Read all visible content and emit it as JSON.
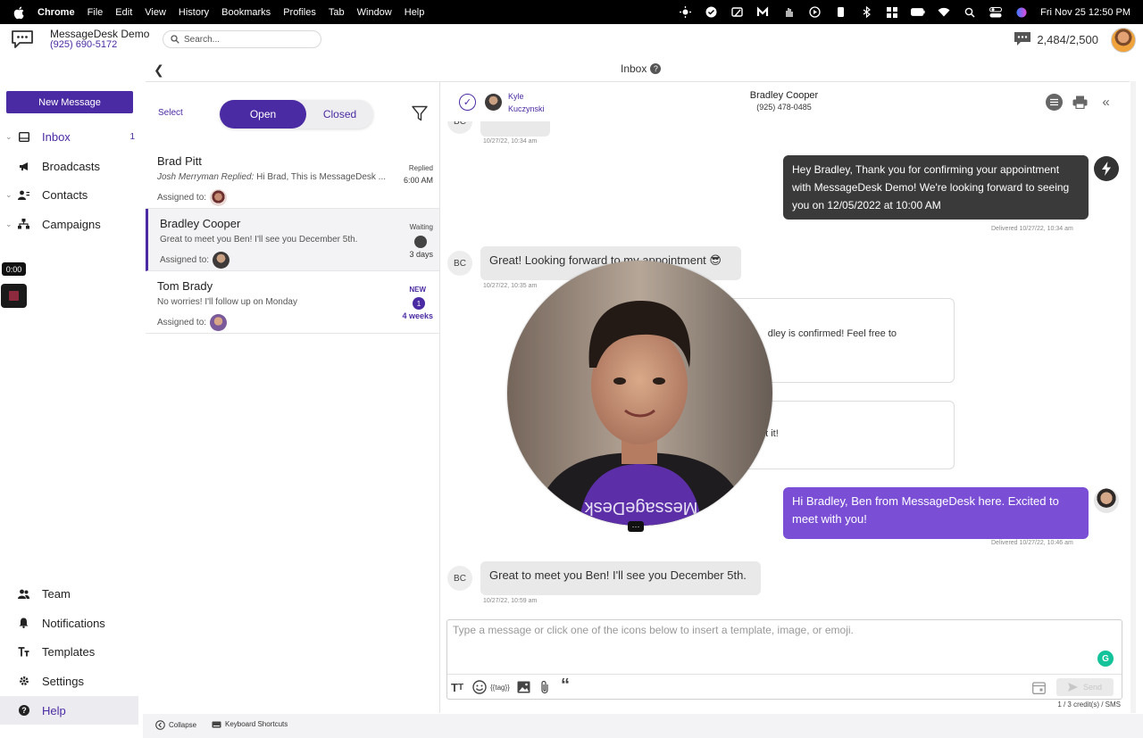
{
  "menubar": {
    "app": "Chrome",
    "menus": [
      "File",
      "Edit",
      "View",
      "History",
      "Bookmarks",
      "Profiles",
      "Tab",
      "Window",
      "Help"
    ],
    "datetime": "Fri Nov 25  12:50 PM"
  },
  "header": {
    "brand_name": "MessageDesk Demo",
    "brand_phone": "(925) 690-5172",
    "search_placeholder": "Search...",
    "credits": "2,484/2,500"
  },
  "nav": {
    "new_message": "New Message",
    "items": [
      {
        "label": "Inbox",
        "count": "1",
        "icon": "inbox-icon"
      },
      {
        "label": "Broadcasts",
        "icon": "megaphone-icon"
      },
      {
        "label": "Contacts",
        "icon": "contacts-icon"
      },
      {
        "label": "Campaigns",
        "icon": "campaigns-icon"
      }
    ],
    "bottom_items": [
      {
        "label": "Team",
        "icon": "team-icon"
      },
      {
        "label": "Notifications",
        "icon": "bell-icon"
      },
      {
        "label": "Templates",
        "icon": "templates-icon"
      },
      {
        "label": "Settings",
        "icon": "gear-icon"
      },
      {
        "label": "Help",
        "icon": "help-icon"
      }
    ],
    "recording_time": "0:00"
  },
  "inbox": {
    "title": "Inbox",
    "select": "Select",
    "tab_open": "Open",
    "tab_closed": "Closed",
    "conversations": [
      {
        "name": "Brad Pitt",
        "preview_author": "Josh Merryman Replied:",
        "preview": " Hi Brad, This is MessageDesk ...",
        "assigned": "Assigned to:",
        "status": "Replied",
        "time": "6:00 AM"
      },
      {
        "name": "Bradley Cooper",
        "preview": "Great to meet you Ben! I'll see you December 5th.",
        "assigned": "Assigned to:",
        "status": "Waiting",
        "time": "3 days"
      },
      {
        "name": "Tom Brady",
        "preview": "No worries! I'll follow up on Monday",
        "assigned": "Assigned to:",
        "status": "NEW",
        "count": "1",
        "time": "4 weeks"
      }
    ]
  },
  "chat": {
    "assignee_first": "Kyle",
    "assignee_last": "Kuczynski",
    "contact_name": "Bradley Cooper",
    "contact_phone": "(925) 478-0485",
    "initials": "BC",
    "messages": {
      "m0_stamp": "10/27/22, 10:34 am",
      "m1_text": "Hey Bradley, Thank you for confirming your appointment with MessageDesk Demo! We're looking forward to seeing you on 12/05/2022 at 10:00 AM",
      "m1_stamp": "Delivered 10/27/22, 10:34 am",
      "m2_text": "Great! Looking forward to my appointment 😎",
      "m2_stamp": "10/27/22, 10:35 am",
      "m3_text": "dley is confirmed! Feel free to",
      "m4_text": "ot it!",
      "m5_text": "Hi Bradley, Ben from MessageDesk here. Excited to meet with you!",
      "m5_stamp": "Delivered 10/27/22, 10:46 am",
      "m6_text": "Great to meet you Ben! I'll see you December 5th.",
      "m6_stamp": "10/27/22, 10:59 am"
    },
    "composer_placeholder": "Type a message or click one of the icons below to insert a template, image, or emoji.",
    "tag_label": "{{tag}}",
    "send": "Send",
    "credit_note": "1 / 3 credit(s) / SMS"
  },
  "footer": {
    "collapse": "Collapse",
    "shortcuts": "Keyboard Shortcuts"
  },
  "colors": {
    "brand_purple": "#4b2ba3",
    "outgoing_purple": "#7a4fd6",
    "outgoing_dark": "#3a3a3a"
  }
}
